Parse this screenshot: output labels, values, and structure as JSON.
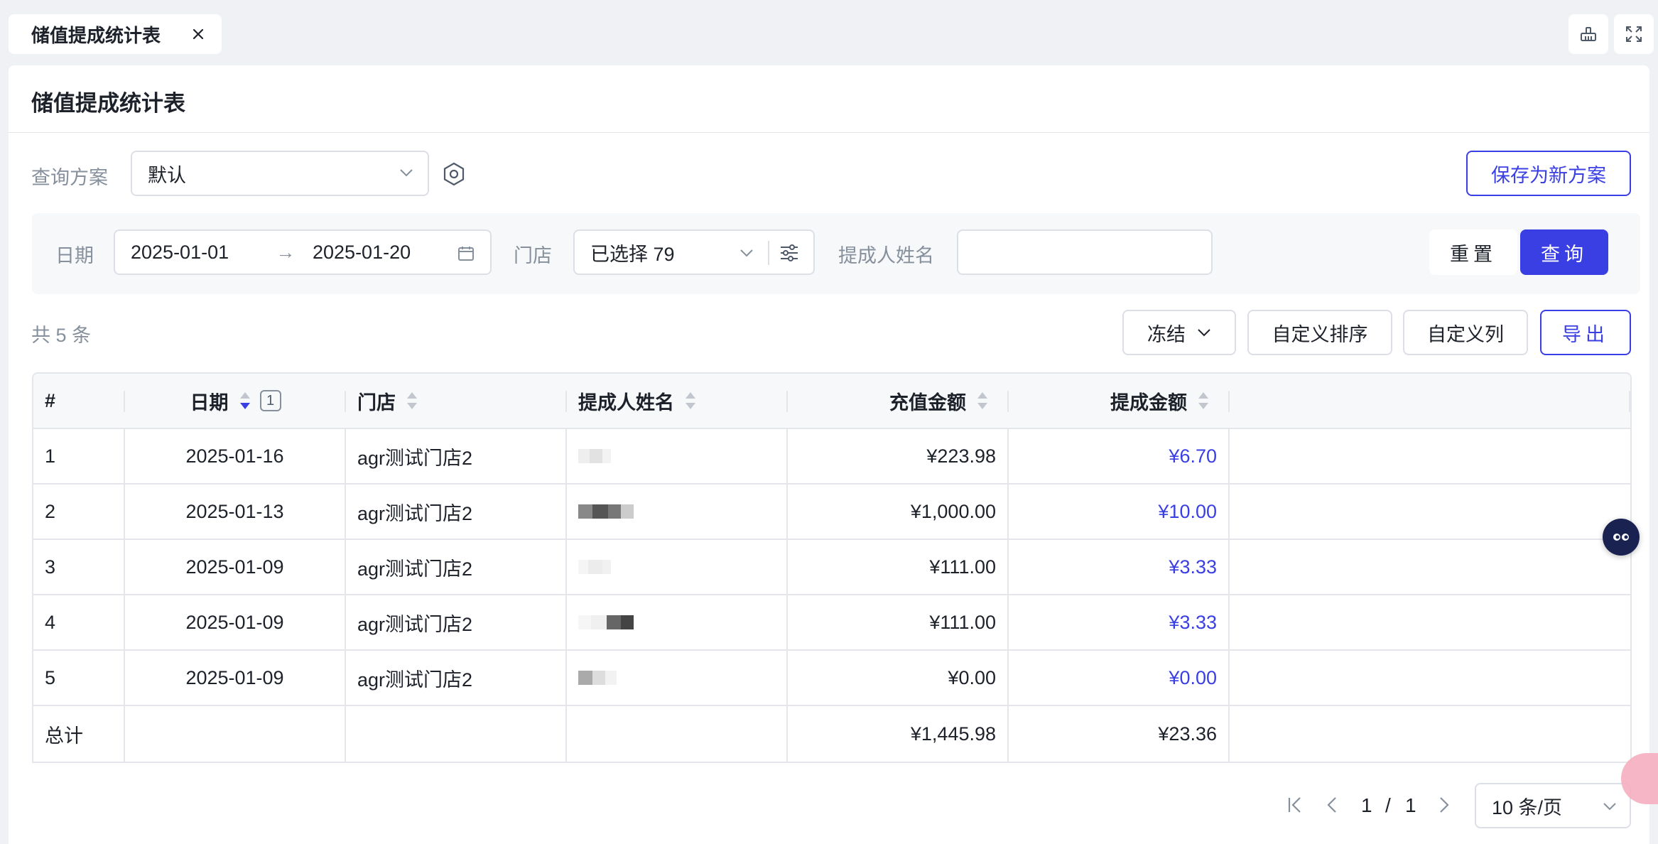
{
  "tab": {
    "label": "储值提成统计表"
  },
  "page": {
    "title": "储值提成统计表"
  },
  "query": {
    "scheme_label": "查询方案",
    "scheme_value": "默认",
    "save_new_label": "保存为新方案"
  },
  "filters": {
    "date_label": "日期",
    "date_start": "2025-01-01",
    "date_sep": "→",
    "date_end": "2025-01-20",
    "store_label": "门店",
    "store_value": "已选择 79",
    "person_label": "提成人姓名",
    "person_value": "",
    "reset_label": "重置",
    "search_label": "查询"
  },
  "toolbar": {
    "count_text": "共 5 条",
    "freeze_label": "冻结",
    "custom_sort_label": "自定义排序",
    "custom_cols_label": "自定义列",
    "export_label": "导出"
  },
  "table": {
    "headers": [
      "#",
      "日期",
      "门店",
      "提成人姓名",
      "充值金额",
      "提成金额"
    ],
    "sort_badge": "1",
    "rows": [
      {
        "no": "1",
        "date": "2025-01-16",
        "store": "agr测试门店2",
        "recharge": "¥223.98",
        "commission": "¥6.70"
      },
      {
        "no": "2",
        "date": "2025-01-13",
        "store": "agr测试门店2",
        "recharge": "¥1,000.00",
        "commission": "¥10.00"
      },
      {
        "no": "3",
        "date": "2025-01-09",
        "store": "agr测试门店2",
        "recharge": "¥111.00",
        "commission": "¥3.33"
      },
      {
        "no": "4",
        "date": "2025-01-09",
        "store": "agr测试门店2",
        "recharge": "¥111.00",
        "commission": "¥3.33"
      },
      {
        "no": "5",
        "date": "2025-01-09",
        "store": "agr测试门店2",
        "recharge": "¥0.00",
        "commission": "¥0.00"
      }
    ],
    "total": {
      "label": "总计",
      "recharge": "¥1,445.98",
      "commission": "¥23.36"
    }
  },
  "pager": {
    "current": "1",
    "sep": "/",
    "total": "1",
    "page_size": "10 条/页"
  },
  "colors": {
    "primary": "#3a3fe4",
    "border": "#dcdfe6",
    "muted": "#86909c"
  }
}
